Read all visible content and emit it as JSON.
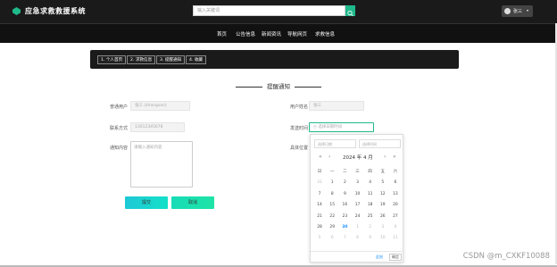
{
  "header": {
    "app_title": "应急求救救援系统",
    "search_placeholder": "输入关键词",
    "user_name": "张三",
    "user_caret": "▾"
  },
  "nav": {
    "items": [
      "首页",
      "公告信息",
      "新闻资讯",
      "导航网页",
      "求救信息"
    ]
  },
  "tabs": [
    "1. 个人首页",
    "2. 求救信息",
    "3. 提醒通知",
    "4. 收藏"
  ],
  "form": {
    "section_title": "提醒通知",
    "labels": {
      "user": "普通用户",
      "username": "用户姓名",
      "contact": "联系方式",
      "send_time": "发送时间",
      "content": "通知内容",
      "location": "具体位置"
    },
    "values": {
      "user": "张三 (zhangsan)",
      "username": "张三",
      "contact": "13012345678",
      "send_time_placeholder": "选择日期时间",
      "content_placeholder": "请输入通知内容"
    },
    "buttons": {
      "submit": "提交",
      "cancel": "取消"
    }
  },
  "picker": {
    "date_placeholder": "选择日期",
    "time_placeholder": "选择时间",
    "year_month": "2024 年  4 月",
    "weekdays": [
      "日",
      "一",
      "二",
      "三",
      "四",
      "五",
      "六"
    ],
    "weeks": [
      [
        "31",
        "1",
        "2",
        "3",
        "4",
        "5",
        "6"
      ],
      [
        "7",
        "8",
        "9",
        "10",
        "11",
        "12",
        "13"
      ],
      [
        "14",
        "15",
        "16",
        "17",
        "18",
        "19",
        "20"
      ],
      [
        "21",
        "22",
        "23",
        "24",
        "25",
        "26",
        "27"
      ],
      [
        "28",
        "29",
        "30",
        "1",
        "2",
        "3",
        "4"
      ],
      [
        "5",
        "6",
        "7",
        "8",
        "9",
        "10",
        "11"
      ]
    ],
    "muted_first_row_count": 1,
    "today": "30",
    "now_label": "此刻",
    "ok_label": "确定"
  },
  "watermark": "CSDN @m_CXKF10088"
}
